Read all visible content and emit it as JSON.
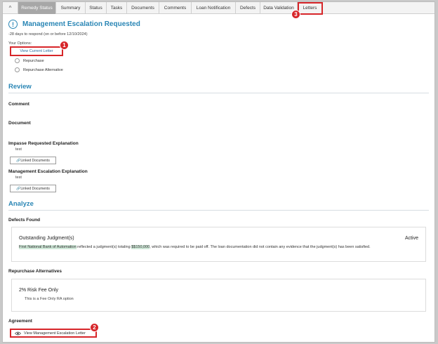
{
  "tabs": [
    {
      "label": "Remedy Status",
      "active": true
    },
    {
      "label": "Summary"
    },
    {
      "label": "Status"
    },
    {
      "label": "Tasks"
    },
    {
      "label": "Documents"
    },
    {
      "label": "Comments"
    },
    {
      "label": "Loan Notification"
    },
    {
      "label": "Defects"
    },
    {
      "label": "Data Validation"
    },
    {
      "label": "Letters"
    }
  ],
  "collapse_glyph": "^",
  "header": {
    "alert_glyph": "!",
    "title": "Management Escalation Requested",
    "days": "-28 days to respond (on or before 12/10/2024)",
    "options_label": "Your Options:",
    "view_letter": "View Current Letter",
    "options": [
      "Repurchase",
      "Repurchase Alternative"
    ]
  },
  "review": {
    "title": "Review",
    "comment_label": "Comment",
    "document_label": "Document",
    "impasse_label": "Impasse Requested Explanation",
    "impasse_value": "test",
    "mgmt_label": "Management Escalation Explanation",
    "mgmt_value": "test",
    "linked_docs": "Linked Documents"
  },
  "analyze": {
    "title": "Analyze",
    "defects_label": "Defects Found",
    "defect": {
      "title": "Outstanding Judgment(s)",
      "status": "Active",
      "desc_hl1": "First National Bank of Automation",
      "desc_mid": " reflected a judgment(s) totaling ",
      "desc_hl2": "$$150,000",
      "desc_tail": ", which was required to be paid off. The loan documentation did not contain any evidence that the judgment(s) has been satisfied."
    },
    "ra_label": "Repurchase Alternatives",
    "ra": {
      "title": "2% Risk Fee Only",
      "desc": "This is a Fee Only RA option"
    },
    "agreement_label": "Agreement",
    "view_mgmt_letter": "View Management Escalation Letter"
  },
  "badges": [
    "1",
    "2",
    "3"
  ],
  "colors": {
    "accent": "#2a86b5",
    "highlight_red": "#d7262a",
    "active_tab": "#a7a7a7"
  }
}
